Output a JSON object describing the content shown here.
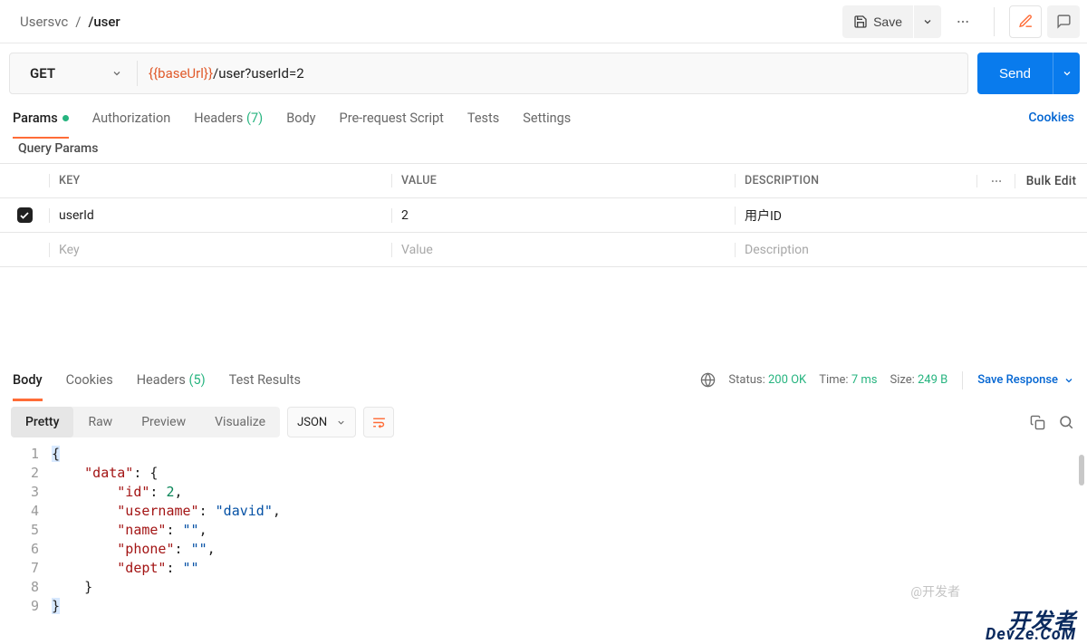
{
  "breadcrumb": {
    "parent": "Usersvc",
    "sep": "/",
    "current": "/user"
  },
  "toolbar": {
    "save_label": "Save",
    "send_label": "Send"
  },
  "request": {
    "method": "GET",
    "url_var": "{{baseUrl}}",
    "url_path": "/user?userId=2"
  },
  "tabs": {
    "params": "Params",
    "authorization": "Authorization",
    "headers": "Headers",
    "headers_count": "(7)",
    "body": "Body",
    "prerequest": "Pre-request Script",
    "tests": "Tests",
    "settings": "Settings",
    "cookies": "Cookies"
  },
  "query_params": {
    "title": "Query Params",
    "header_key": "KEY",
    "header_value": "VALUE",
    "header_desc": "DESCRIPTION",
    "bulk_edit": "Bulk Edit",
    "rows": [
      {
        "checked": true,
        "key": "userId",
        "value": "2",
        "desc": "用户ID"
      }
    ],
    "placeholder_key": "Key",
    "placeholder_value": "Value",
    "placeholder_desc": "Description"
  },
  "response": {
    "tabs": {
      "body": "Body",
      "cookies": "Cookies",
      "headers": "Headers",
      "headers_count": "(5)",
      "tests": "Test Results"
    },
    "status_label": "Status:",
    "status_value": "200 OK",
    "time_label": "Time:",
    "time_value": "7 ms",
    "size_label": "Size:",
    "size_value": "249 B",
    "save_response": "Save Response",
    "views": {
      "pretty": "Pretty",
      "raw": "Raw",
      "preview": "Preview",
      "visualize": "Visualize"
    },
    "format": "JSON",
    "body_lines": [
      {
        "n": 1,
        "indent": 0,
        "tokens": [
          {
            "t": "punc",
            "v": "{"
          }
        ],
        "cursor": true
      },
      {
        "n": 2,
        "indent": 1,
        "tokens": [
          {
            "t": "key",
            "v": "\"data\""
          },
          {
            "t": "punc",
            "v": ": {"
          }
        ]
      },
      {
        "n": 3,
        "indent": 2,
        "tokens": [
          {
            "t": "key",
            "v": "\"id\""
          },
          {
            "t": "punc",
            "v": ": "
          },
          {
            "t": "num",
            "v": "2"
          },
          {
            "t": "punc",
            "v": ","
          }
        ]
      },
      {
        "n": 4,
        "indent": 2,
        "tokens": [
          {
            "t": "key",
            "v": "\"username\""
          },
          {
            "t": "punc",
            "v": ": "
          },
          {
            "t": "str",
            "v": "\"david\""
          },
          {
            "t": "punc",
            "v": ","
          }
        ]
      },
      {
        "n": 5,
        "indent": 2,
        "tokens": [
          {
            "t": "key",
            "v": "\"name\""
          },
          {
            "t": "punc",
            "v": ": "
          },
          {
            "t": "str",
            "v": "\"\""
          },
          {
            "t": "punc",
            "v": ","
          }
        ]
      },
      {
        "n": 6,
        "indent": 2,
        "tokens": [
          {
            "t": "key",
            "v": "\"phone\""
          },
          {
            "t": "punc",
            "v": ": "
          },
          {
            "t": "str",
            "v": "\"\""
          },
          {
            "t": "punc",
            "v": ","
          }
        ]
      },
      {
        "n": 7,
        "indent": 2,
        "tokens": [
          {
            "t": "key",
            "v": "\"dept\""
          },
          {
            "t": "punc",
            "v": ": "
          },
          {
            "t": "str",
            "v": "\"\""
          }
        ]
      },
      {
        "n": 8,
        "indent": 1,
        "tokens": [
          {
            "t": "punc",
            "v": "}"
          }
        ]
      },
      {
        "n": 9,
        "indent": 0,
        "tokens": [
          {
            "t": "punc",
            "v": "}"
          }
        ],
        "cursor": true
      }
    ]
  },
  "watermark": {
    "handle": "@开发者",
    "line1": "开发者",
    "line2": "DevZe.CoM"
  }
}
